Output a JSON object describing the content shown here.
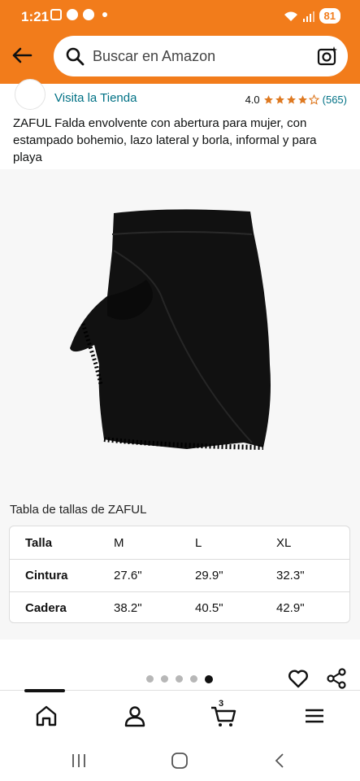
{
  "status_bar": {
    "time": "1:21",
    "battery": "81"
  },
  "search": {
    "placeholder": "Buscar en Amazon"
  },
  "store": {
    "link_text": "Visita la Tienda",
    "rating": "4.0",
    "review_count": "(565)"
  },
  "product": {
    "title": "ZAFUL Falda envolvente con abertura para mujer, con estampado bohemio, lazo lateral y borla, informal y para playa",
    "image_alt_icon": "skirt-image"
  },
  "size_chart": {
    "title": "Tabla de tallas de ZAFUL",
    "headers": [
      "Talla",
      "M",
      "L",
      "XL"
    ],
    "rows": [
      [
        "Cintura",
        "27.6\"",
        "29.9\"",
        "32.3\""
      ],
      [
        "Cadera",
        "38.2\"",
        "40.5\"",
        "42.9\""
      ]
    ]
  },
  "gallery": {
    "total": 5,
    "active_index": 4
  },
  "cart": {
    "count": "3"
  },
  "colors": {
    "header": "#f27c1b",
    "link": "#007185",
    "star": "#de7921"
  }
}
